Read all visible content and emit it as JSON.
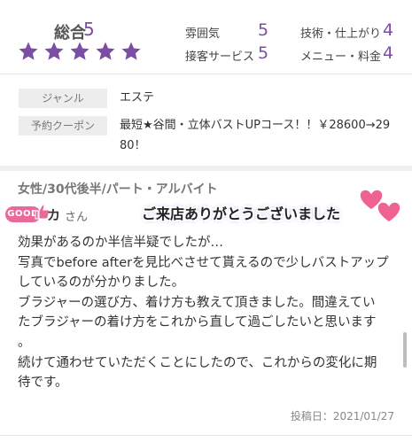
{
  "summary": {
    "overall_label": "総合",
    "overall_score": "5",
    "stars": 5,
    "ratings": [
      {
        "label": "雰囲気",
        "value": "5"
      },
      {
        "label": "技術・仕上がり",
        "value": "4"
      },
      {
        "label": "接客サービス",
        "value": "5"
      },
      {
        "label": "メニュー・料金",
        "value": "4"
      }
    ]
  },
  "info": {
    "genre_label": "ジャンル",
    "genre_value": "エステ",
    "coupon_label": "予約クーポン",
    "coupon_line1": "最短★谷間・立体バストUPコース！！￥28600→29",
    "coupon_line2": "80！"
  },
  "review": {
    "meta": "女性/30代後半/パート・アルバイト",
    "badge": "GOOD",
    "name": "カ",
    "name_suffix": "さん",
    "thanks": "ご来店ありがとうございました",
    "body": "効果があるのか半信半疑でしたが…\n写真でbefore afterを見比べさせて貰えるので少しバストアップ\nしているのが分かりました。\nブラジャーの選び方、着け方も教えて頂きました。間違えてい\nたブラジャーの着け方をこれから直して過ごしたいと思います\n。\n続けて通わせていただくことにしたので、これからの変化に期\n待です。",
    "post_date": "投稿日：2021/01/27"
  },
  "colors": {
    "accent": "#7b4ea3",
    "badge": "#e96a9a",
    "heart": "#f06292"
  }
}
